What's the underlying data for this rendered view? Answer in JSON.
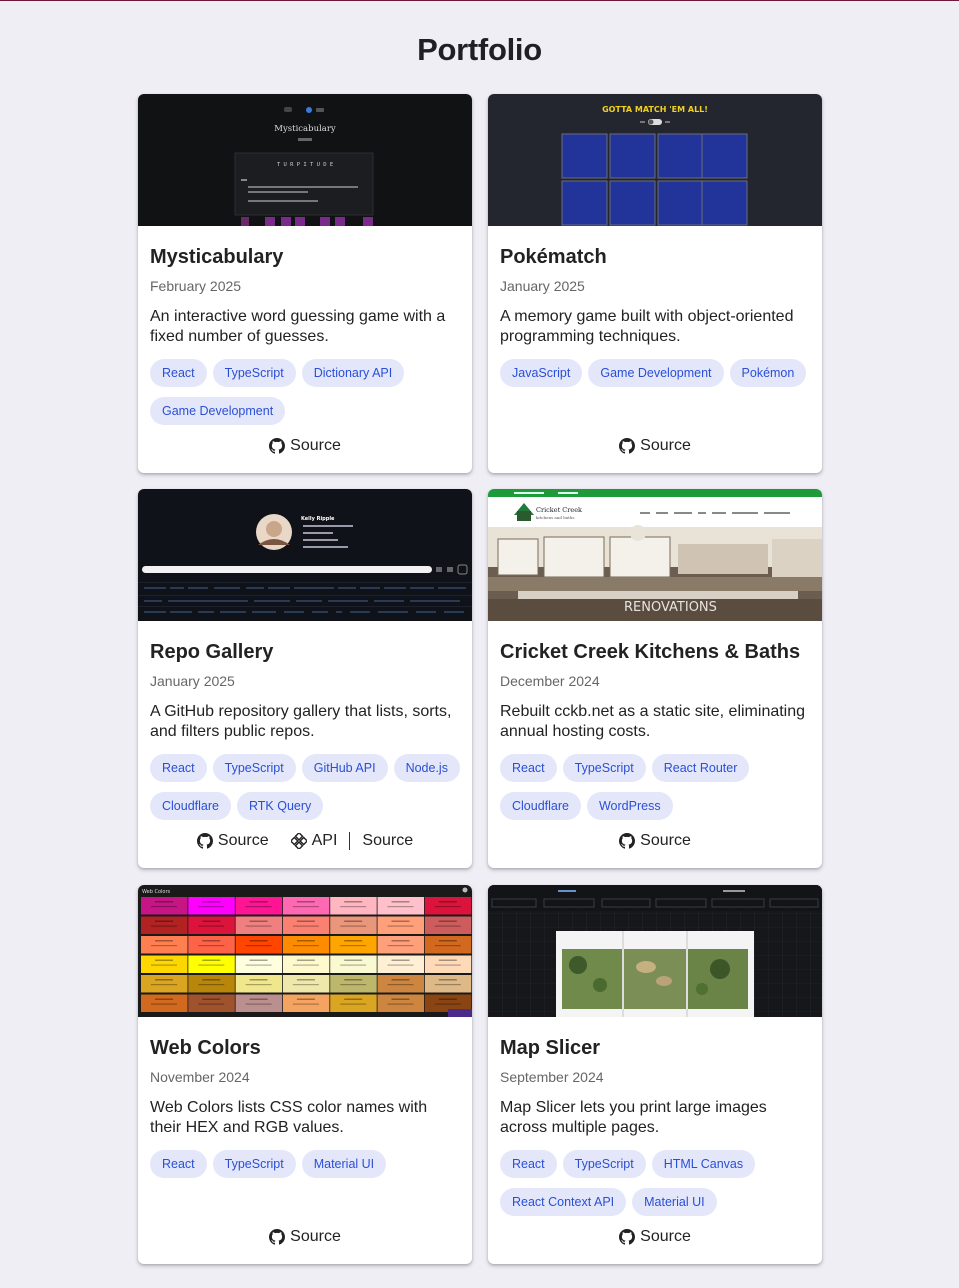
{
  "page": {
    "title": "Portfolio"
  },
  "projects": [
    {
      "title": "Mysticabulary",
      "date": "February 2025",
      "description": "An interactive word guessing game with a fixed number of guesses.",
      "tags": [
        "React",
        "TypeScript",
        "Dictionary API",
        "Game Development"
      ],
      "links": [
        {
          "icon": "github-icon",
          "label": "Source"
        }
      ]
    },
    {
      "title": "Pokématch",
      "date": "January 2025",
      "description": "A memory game built with object-oriented programming techniques.",
      "tags": [
        "JavaScript",
        "Game Development",
        "Pokémon"
      ],
      "links": [
        {
          "icon": "github-icon",
          "label": "Source"
        }
      ]
    },
    {
      "title": "Repo Gallery",
      "date": "January 2025",
      "description": "A GitHub repository gallery that lists, sorts, and filters public repos.",
      "tags": [
        "React",
        "TypeScript",
        "GitHub API",
        "Node.js",
        "Cloudflare",
        "RTK Query"
      ],
      "links": [
        {
          "icon": "github-icon",
          "label": "Source"
        },
        {
          "icon": "api-icon",
          "label": "API"
        },
        {
          "icon": "",
          "label": "Source"
        }
      ]
    },
    {
      "title": "Cricket Creek Kitchens & Baths",
      "date": "December 2024",
      "description": "Rebuilt cckb.net as a static site, eliminating annual hosting costs.",
      "tags": [
        "React",
        "TypeScript",
        "React Router",
        "Cloudflare",
        "WordPress"
      ],
      "links": [
        {
          "icon": "github-icon",
          "label": "Source"
        }
      ]
    },
    {
      "title": "Web Colors",
      "date": "November 2024",
      "description": "Web Colors lists CSS color names with their HEX and RGB values.",
      "tags": [
        "React",
        "TypeScript",
        "Material UI"
      ],
      "links": [
        {
          "icon": "github-icon",
          "label": "Source"
        }
      ]
    },
    {
      "title": "Map Slicer",
      "date": "September 2024",
      "description": "Map Slicer lets you print large images across multiple pages.",
      "tags": [
        "React",
        "TypeScript",
        "HTML Canvas",
        "React Context API",
        "Material UI"
      ],
      "links": [
        {
          "icon": "github-icon",
          "label": "Source"
        }
      ]
    }
  ],
  "thumbnails": {
    "mysticabulary": {
      "heading": "Mysticabulary",
      "word": "T U R P I T U D E"
    },
    "pokematch": {
      "heading": "GOTTA MATCH 'EM ALL!"
    },
    "repo_gallery": {
      "name": "Kelly Ripple"
    },
    "cricket_creek": {
      "brand": "Cricket Creek",
      "brand_sub": "kitchens and baths",
      "hero_text": "RENOVATIONS"
    },
    "web_colors": {
      "heading": "Web Colors"
    }
  },
  "colors": {
    "tag_bg": "#e4e7fa",
    "tag_text": "#2a4fd6",
    "page_bg": "#efeef5"
  }
}
